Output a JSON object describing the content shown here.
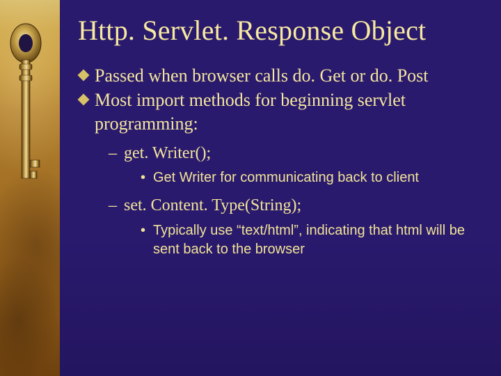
{
  "title": "Http. Servlet. Response Object",
  "bullets": [
    {
      "text": "Passed when browser calls do. Get or do. Post"
    },
    {
      "text": "Most import methods for beginning servlet programming:",
      "sub": [
        {
          "text": "get. Writer();",
          "sub": [
            {
              "text": "Get Writer for communicating back to client"
            }
          ]
        },
        {
          "text": "set. Content. Type(String);",
          "sub": [
            {
              "text": "Typically use “text/html”, indicating that html will be sent back to the browser"
            }
          ]
        }
      ]
    }
  ]
}
